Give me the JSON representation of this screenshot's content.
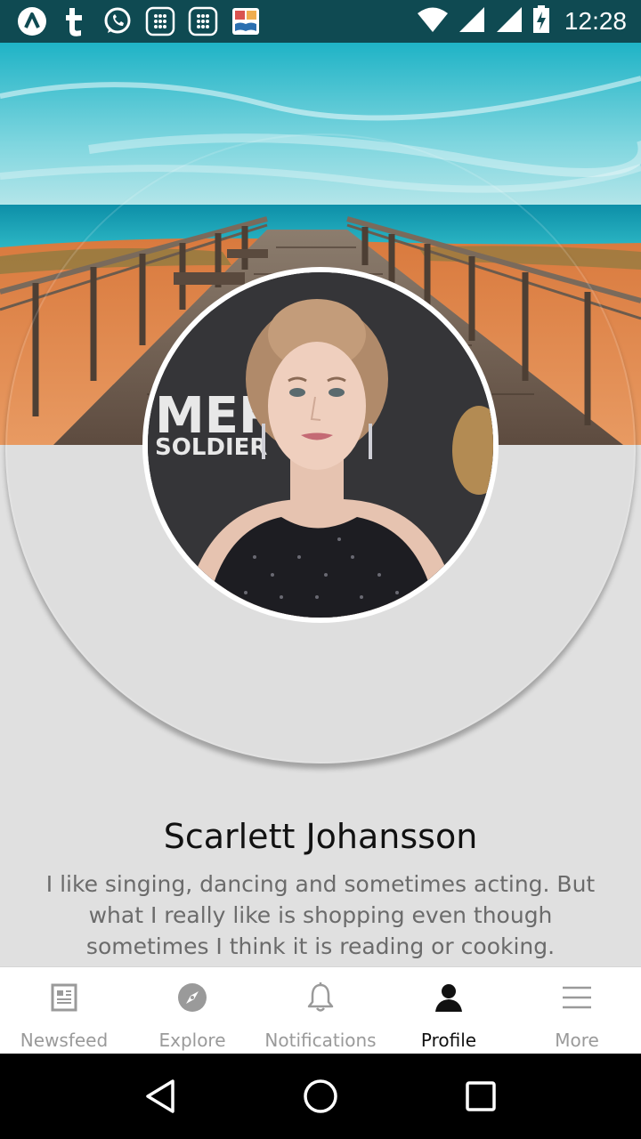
{
  "status_bar": {
    "time": "12:28",
    "left_icons": [
      "arc-app-icon",
      "tumblr-icon",
      "whatsapp-icon",
      "dialpad-app-icon",
      "dialpad-app-icon-2",
      "book-app-icon"
    ],
    "right_icons": [
      "wifi-icon",
      "signal-icon",
      "signal-icon-2",
      "battery-charging-icon"
    ]
  },
  "profile": {
    "name": "Scarlett Johansson",
    "bio": "I like singing, dancing and sometimes acting. But what I really like is shopping even though sometimes I think it is reading or cooking."
  },
  "tabs": [
    {
      "label": "Newsfeed",
      "icon": "newspaper-icon",
      "active": false
    },
    {
      "label": "Explore",
      "icon": "compass-icon",
      "active": false
    },
    {
      "label": "Notifications",
      "icon": "bell-icon",
      "active": false
    },
    {
      "label": "Profile",
      "icon": "person-icon",
      "active": true
    },
    {
      "label": "More",
      "icon": "menu-icon",
      "active": false
    }
  ],
  "nav": {
    "back": "back-icon",
    "home": "home-icon",
    "recents": "recents-icon"
  },
  "colors": {
    "status_bar": "#0f4a52",
    "background": "#e0e0e0",
    "tab_active": "#111111",
    "tab_inactive": "#9a9a9a"
  }
}
